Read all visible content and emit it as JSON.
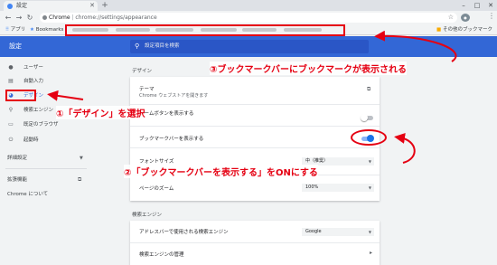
{
  "browser": {
    "tab_title": "設定",
    "url_scheme": "Chrome",
    "url_path": "chrome://settings/appearance",
    "bookmarks": {
      "apps_label": "アプリ",
      "bookmarks_label": "Bookmarks",
      "other_label": "その他のブックマーク"
    }
  },
  "header": {
    "title": "設定",
    "search_placeholder": "設定項目を検索"
  },
  "sidebar": {
    "items": [
      {
        "label": "ユーザー",
        "icon": "person-icon"
      },
      {
        "label": "自動入力",
        "icon": "clipboard-icon"
      },
      {
        "label": "デザイン",
        "icon": "palette-icon"
      },
      {
        "label": "検索エンジン",
        "icon": "search-icon"
      },
      {
        "label": "既定のブラウザ",
        "icon": "browser-icon"
      },
      {
        "label": "起動時",
        "icon": "power-icon"
      }
    ],
    "advanced_label": "詳細設定",
    "extensions_label": "拡張機能",
    "about_label": "Chrome について"
  },
  "appearance": {
    "heading": "デザイン",
    "theme_label": "テーマ",
    "theme_sub": "Chrome ウェブストアを開きます",
    "home_button_label": "ホームボタンを表示する",
    "home_button_on": false,
    "bookmarks_bar_label": "ブックマークバーを表示する",
    "bookmarks_bar_on": true,
    "font_size_label": "フォントサイズ",
    "font_size_value": "中（推奨）",
    "zoom_label": "ページのズーム",
    "zoom_value": "100%"
  },
  "search_engine": {
    "heading": "検索エンジン",
    "engine_label": "アドレスバーで使用される検索エンジン",
    "engine_value": "Google",
    "manage_label": "検索エンジンの管理"
  },
  "annotations": {
    "step1": "①「デザイン」を選択",
    "step2": "②「ブックマークバーを表示する」をONにする",
    "step3": "③ブックマークバーにブックマークが表示される",
    "color": "#e50012"
  }
}
